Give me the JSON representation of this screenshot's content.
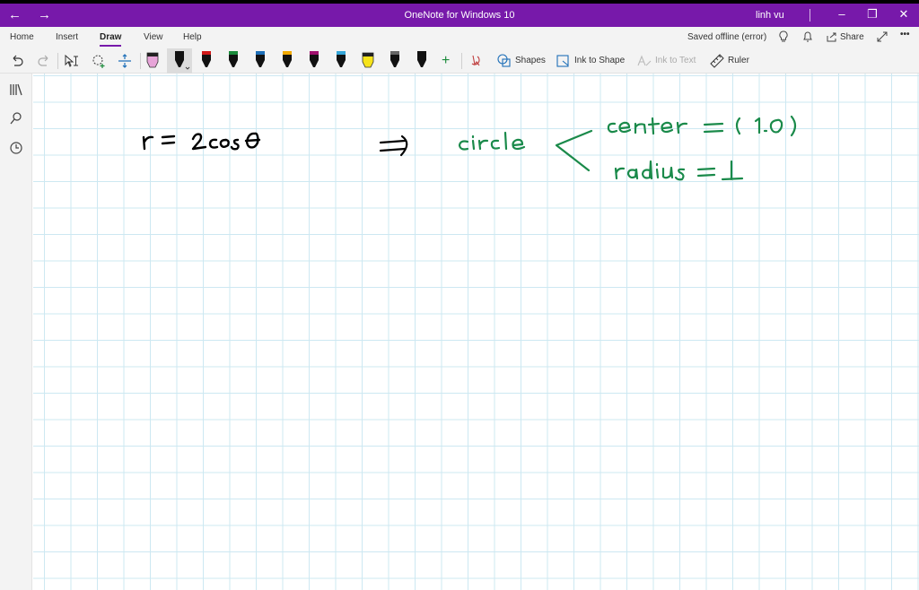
{
  "titlebar": {
    "title": "OneNote for Windows 10",
    "user": "linh vu",
    "back_icon": "arrow-left-icon",
    "forward_icon": "arrow-right-icon",
    "minimize": "–",
    "restore": "❐",
    "close": "✕",
    "back": "←",
    "forward": "→"
  },
  "ribbon": {
    "tabs": [
      "Home",
      "Insert",
      "Draw",
      "View",
      "Help"
    ],
    "active_tab": "Draw",
    "status": "Saved offline (error)",
    "share_label": "Share",
    "more": "•••"
  },
  "toolbar": {
    "shapes_label": "Shapes",
    "ink_to_shape_label": "Ink to Shape",
    "ink_to_text_label": "Ink to Text",
    "ruler_label": "Ruler",
    "add_pen": "+",
    "pens": [
      {
        "color": "#e7a4d8",
        "type": "highlighter"
      },
      {
        "color": "#111111",
        "type": "pen-selected"
      },
      {
        "color": "#d01818",
        "type": "pen"
      },
      {
        "color": "#1a8a3a",
        "type": "pen"
      },
      {
        "color": "#1e6fb8",
        "type": "pen"
      },
      {
        "color": "#f2a900",
        "type": "pen"
      },
      {
        "color": "#a0106e",
        "type": "pen"
      },
      {
        "color": "#35a6d8",
        "type": "pen"
      },
      {
        "color": "#f6e31a",
        "type": "highlighter"
      },
      {
        "color": "#666666",
        "type": "pencil"
      },
      {
        "color": "#111111",
        "type": "pen"
      }
    ]
  },
  "colors": {
    "accent": "#7719aa",
    "ink_black": "#000000",
    "ink_green": "#1a8a4a",
    "grid": "#cde8f2"
  },
  "note": {
    "equation": "r = 2cosθ",
    "arrow": "⇒",
    "shape": "circle",
    "center": "center = (1,0)",
    "radius": "radius = 1"
  }
}
